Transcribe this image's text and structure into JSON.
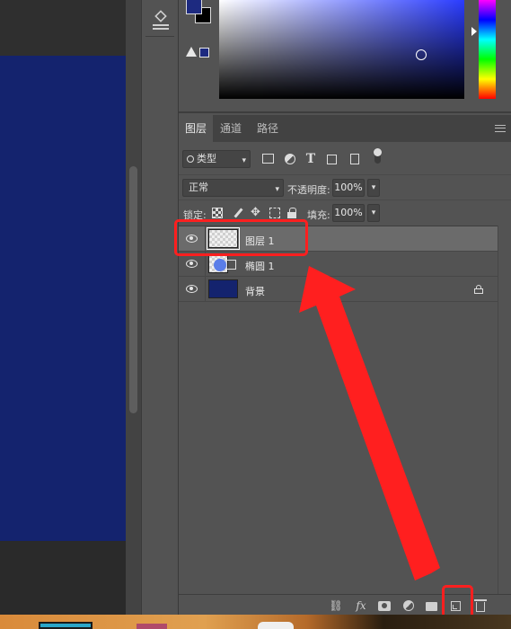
{
  "colors": {
    "foreground": "#1d2a80",
    "background": "#000000",
    "canvas_fill": "#14236e",
    "highlight": "#ff1f1f"
  },
  "layers_panel": {
    "tabs": [
      {
        "label": "图层",
        "active": true
      },
      {
        "label": "通道",
        "active": false
      },
      {
        "label": "路径",
        "active": false
      }
    ],
    "filter": {
      "label": "类型"
    },
    "blend_mode": "正常",
    "opacity_label": "不透明度:",
    "opacity_value": "100%",
    "lock_label": "锁定:",
    "fill_label": "填充:",
    "fill_value": "100%",
    "layers": [
      {
        "name": "图层 1",
        "visible": true,
        "selected": true,
        "thumb": "transparent"
      },
      {
        "name": "椭圆 1",
        "visible": true,
        "selected": false,
        "thumb": "ellipse-shape"
      },
      {
        "name": "背景",
        "visible": true,
        "selected": false,
        "thumb": "fill",
        "locked": true
      }
    ],
    "bottom_icons": [
      "link-icon",
      "fx-icon",
      "mask-icon",
      "adjustment-icon",
      "folder-icon",
      "new-layer-icon",
      "trash-icon"
    ],
    "fx_label": "fx"
  }
}
